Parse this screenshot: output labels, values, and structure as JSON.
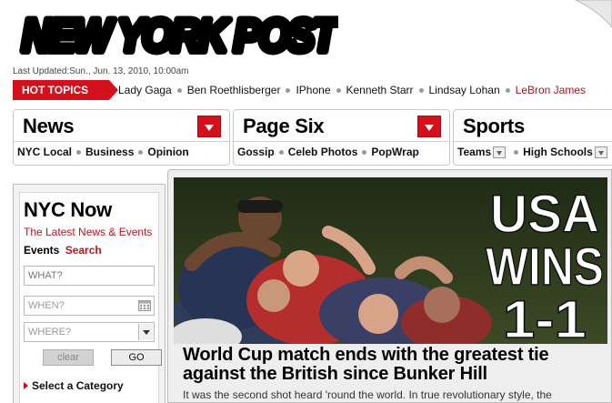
{
  "masthead": {
    "logo_text": "NEW YORK POST"
  },
  "last_updated": "Last Updated:Sun., Jun. 13, 2010, 10:00am",
  "hot_topics": {
    "label": "HOT TOPICS",
    "items": [
      "Lady Gaga",
      "Ben Roethlisberger",
      "IPhone",
      "Kenneth Starr",
      "Lindsay Lohan",
      "LeBron James"
    ]
  },
  "sections": [
    {
      "title": "News",
      "links": [
        "NYC Local",
        "Business",
        "Opinion"
      ]
    },
    {
      "title": "Page Six",
      "links": [
        "Gossip",
        "Celeb Photos",
        "PopWrap"
      ]
    },
    {
      "title": "Sports",
      "links": [
        "Teams",
        "High Schools"
      ]
    }
  ],
  "nyc_now": {
    "title": "NYC Now",
    "subtitle": "The Latest News & Events",
    "tab_events": "Events",
    "tab_search": "Search",
    "what_placeholder": "WHAT?",
    "when_placeholder": "WHEN?",
    "where_placeholder": "WHERE?",
    "clear_label": "clear",
    "go_label": "GO",
    "category_label": "Select a Category"
  },
  "story": {
    "photo_overlay": [
      "USA",
      "WINS",
      "1-1"
    ],
    "headline": "World Cup match ends with the greatest tie against the British since Bunker Hill",
    "dek": "It was the second shot heard 'round the world. In true revolutionary style, the"
  },
  "colors": {
    "brand_red": "#d4101c",
    "link_red": "#c4101b"
  }
}
